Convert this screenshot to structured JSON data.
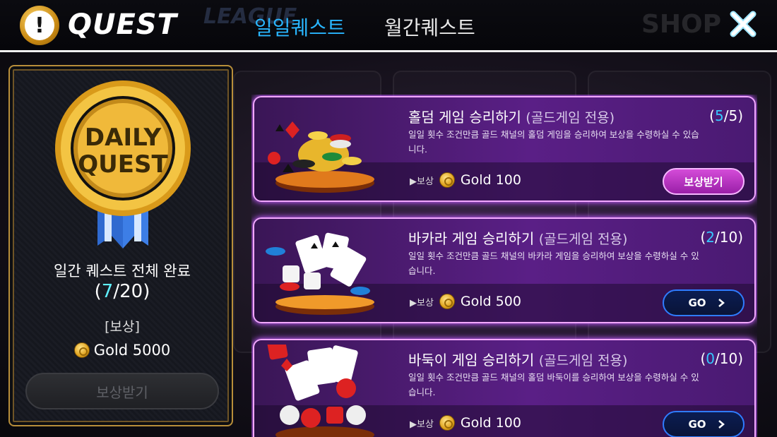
{
  "header": {
    "title": "QUEST",
    "tabs": [
      {
        "label": "일일퀘스트",
        "active": true
      },
      {
        "label": "월간퀘스트",
        "active": false
      }
    ],
    "background_text": {
      "league": "LEAGUE",
      "shop": "SHOP"
    }
  },
  "daily_summary": {
    "medal_text_top": "DAILY",
    "medal_text_bottom": "QUEST",
    "title": "일간 퀘스트 전체 완료",
    "progress_current": "7",
    "progress_total": "20",
    "reward_label": "[보상]",
    "reward_value": "Gold 5000",
    "claim_label": "보상받기"
  },
  "quests": [
    {
      "title": "홀덤 게임 승리하기",
      "subtitle": "(골드게임 전용)",
      "progress_current": "5",
      "progress_total": "5",
      "description": "일일 횟수 조건만큼 골드 채널의 홀덤 게임을 승리하여 보상을 수령하실 수 있습니다.",
      "reward_label": "▶보상",
      "reward_value": "Gold 100",
      "button_label": "보상받기",
      "button_type": "claim"
    },
    {
      "title": "바카라 게임 승리하기",
      "subtitle": "(골드게임 전용)",
      "progress_current": "2",
      "progress_total": "10",
      "description": "일일 횟수 조건만큼 골드 채널의 바카라 게임을 승리하여 보상을 수령하실 수 있습니다.",
      "reward_label": "▶보상",
      "reward_value": "Gold 500",
      "button_label": "GO",
      "button_type": "go"
    },
    {
      "title": "바둑이 게임 승리하기",
      "subtitle": "(골드게임 전용)",
      "progress_current": "0",
      "progress_total": "10",
      "description": "일일 횟수 조건만큼 골드 채널의 홀덤 바둑이를 승리하여 보상을 수령하실 수 있습니다.",
      "reward_label": "▶보상",
      "reward_value": "Gold 100",
      "button_label": "GO",
      "button_type": "go"
    }
  ],
  "colors": {
    "active_tab": "#29b6ff",
    "card_border": "#f2a8ff",
    "progress_highlight": "#36c8ff",
    "claim_button": "#c03bd0",
    "go_button_border": "#2f7cff"
  },
  "icons": [
    "exclamation-icon",
    "close-icon",
    "coin-icon",
    "chevron-right-icon"
  ]
}
